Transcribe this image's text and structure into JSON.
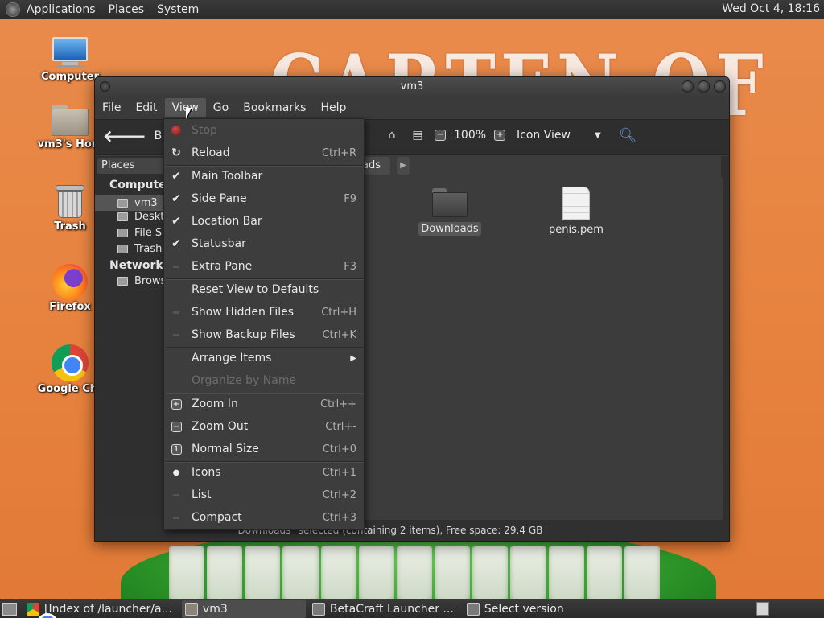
{
  "top_panel": {
    "menus": [
      "Applications",
      "Places",
      "System"
    ],
    "clock": "Wed Oct  4, 18:16"
  },
  "wallpaper": {
    "title_text": "CARTEN OF"
  },
  "desktop_icons": [
    {
      "label": "Computer",
      "icon": "computer-icon"
    },
    {
      "label": "vm3's Hom",
      "icon": "home-folder-icon"
    },
    {
      "label": "Trash",
      "icon": "trash-icon"
    },
    {
      "label": "Firefox",
      "icon": "firefox-icon"
    },
    {
      "label": "Google Chr",
      "icon": "chrome-icon"
    }
  ],
  "window": {
    "title": "vm3",
    "menubar": [
      "File",
      "Edit",
      "View",
      "Go",
      "Bookmarks",
      "Help"
    ],
    "toolbar": {
      "back_label": "Back",
      "zoom": "100%",
      "view_mode": "Icon View"
    },
    "side_pane": {
      "header": "Places",
      "sections": [
        {
          "title": "Computer",
          "items": [
            "vm3",
            "Deskt",
            "File S",
            "Trash"
          ]
        },
        {
          "title": "Network",
          "items": [
            "Brows"
          ]
        }
      ]
    },
    "location": {
      "current": "ads"
    },
    "files": [
      {
        "name": "Downloads",
        "type": "folder",
        "selected": true
      },
      {
        "name": "penis.pem",
        "type": "document",
        "selected": false
      }
    ],
    "status_text": "\"Downloads\" selected (containing 2 items), Free space: 29.4 GB"
  },
  "view_menu": {
    "items": [
      {
        "label": "Stop",
        "shortcut": "",
        "mark": "stop",
        "disabled": true
      },
      {
        "label": "Reload",
        "shortcut": "Ctrl+R",
        "mark": "reload",
        "disabled": false
      },
      {
        "label": "Main Toolbar",
        "shortcut": "",
        "mark": "check",
        "disabled": false
      },
      {
        "label": "Side Pane",
        "shortcut": "F9",
        "mark": "check",
        "disabled": false
      },
      {
        "label": "Location Bar",
        "shortcut": "",
        "mark": "check",
        "disabled": false
      },
      {
        "label": "Statusbar",
        "shortcut": "",
        "mark": "check",
        "disabled": false
      },
      {
        "label": "Extra Pane",
        "shortcut": "F3",
        "mark": "none",
        "disabled": false
      },
      {
        "label": "Reset View to Defaults",
        "shortcut": "",
        "mark": "",
        "disabled": false
      },
      {
        "label": "Show Hidden Files",
        "shortcut": "Ctrl+H",
        "mark": "none",
        "disabled": false
      },
      {
        "label": "Show Backup Files",
        "shortcut": "Ctrl+K",
        "mark": "none",
        "disabled": false
      },
      {
        "label": "Arrange Items",
        "shortcut": "",
        "mark": "",
        "disabled": false,
        "submenu": true
      },
      {
        "label": "Organize by Name",
        "shortcut": "",
        "mark": "",
        "disabled": true
      },
      {
        "label": "Zoom In",
        "shortcut": "Ctrl++",
        "mark": "zoom-in",
        "disabled": false
      },
      {
        "label": "Zoom Out",
        "shortcut": "Ctrl+-",
        "mark": "zoom-out",
        "disabled": false
      },
      {
        "label": "Normal Size",
        "shortcut": "Ctrl+0",
        "mark": "zoom-normal",
        "disabled": false
      },
      {
        "label": "Icons",
        "shortcut": "Ctrl+1",
        "mark": "radio-on",
        "disabled": false
      },
      {
        "label": "List",
        "shortcut": "Ctrl+2",
        "mark": "none",
        "disabled": false
      },
      {
        "label": "Compact",
        "shortcut": "Ctrl+3",
        "mark": "none",
        "disabled": false
      }
    ]
  },
  "bottom_panel": {
    "tasks": [
      {
        "label": "[Index of /launcher/a...",
        "icon": "chrome-icon",
        "active": false
      },
      {
        "label": "vm3",
        "icon": "folder-icon",
        "active": true
      },
      {
        "label": "BetaCraft Launcher ...",
        "icon": "java-app-icon",
        "active": false
      },
      {
        "label": "Select version",
        "icon": "java-app-icon",
        "active": false
      }
    ]
  }
}
